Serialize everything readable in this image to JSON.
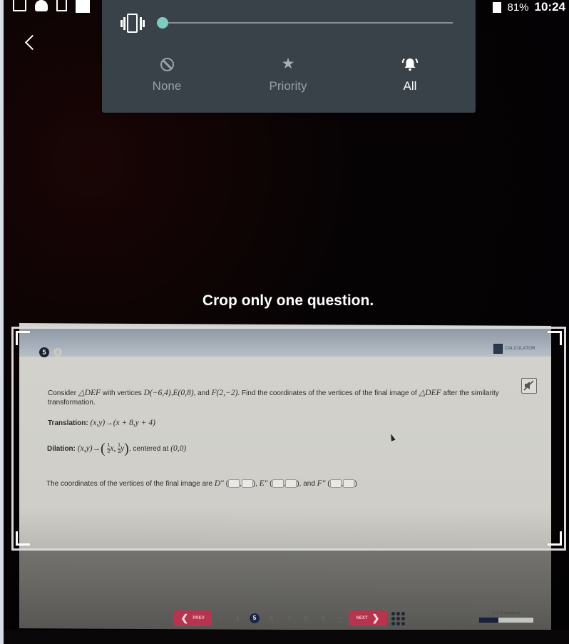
{
  "status_bar": {
    "notification_icons": [
      "gmail-icon",
      "snapchat-icon",
      "gallery-icon",
      "white-square-icon"
    ],
    "battery_percent": "81%",
    "time": "10:24"
  },
  "volume_panel": {
    "vibrate_icon": "vibrate-icon",
    "volume_level": 0,
    "modes": [
      {
        "label": "None",
        "icon": "none-icon",
        "active": false
      },
      {
        "label": "Priority",
        "icon": "star-icon",
        "active": false
      },
      {
        "label": "All",
        "icon": "bell-ringing-icon",
        "active": true
      }
    ]
  },
  "crop": {
    "hint": "Crop only one question."
  },
  "question": {
    "number": "5",
    "info": "i",
    "calculator_label": "CALCULATOR",
    "text_intro": "Consider",
    "triangle": "△DEF",
    "with_vertices": "with vertices",
    "vertex_d": "D(−6,4)",
    "vertex_e": "E(0,8)",
    "and_word": ", and",
    "vertex_f": "F(2,−2)",
    "text_find": ". Find the coordinates of the vertices of the final image of",
    "text_after": "after the similarity transformation.",
    "translation_label": "Translation:",
    "translation_rule": "(x,y)→(x + 8,y + 4)",
    "dilation_label": "Dilation:",
    "dilation_lhs": "(x,y)→",
    "dilation_frac_num": "1",
    "dilation_frac_den": "2",
    "dilation_var_x": "x,",
    "dilation_var_y": "y",
    "centered_text": ", centered at",
    "center_point": "(0,0)",
    "answer_prefix": "The coordinates of the vertices of the final image are",
    "answer_d": "D″",
    "answer_e": "E″",
    "answer_f": "F″",
    "answer_and": ", and"
  },
  "pager": {
    "prev_label": "PREV",
    "next_label": "NEXT",
    "pages": [
      "4",
      "5",
      "6",
      "7",
      "8",
      "9"
    ],
    "current": "5",
    "ellipsis": "–"
  },
  "progress": {
    "label": "4 of 11 answered",
    "fraction": 0.36
  }
}
